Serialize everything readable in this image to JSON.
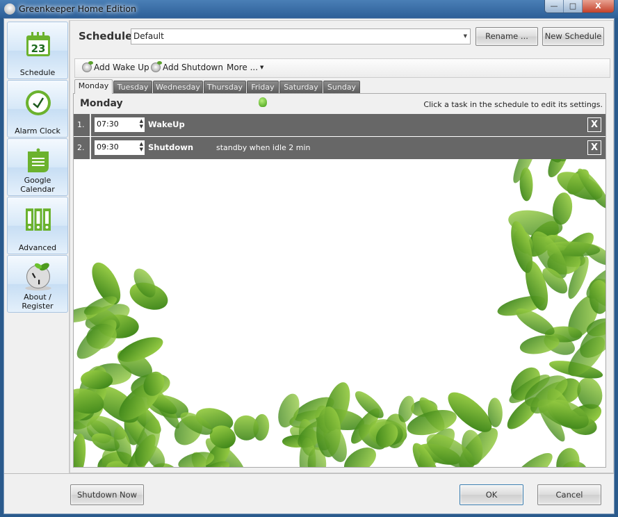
{
  "window": {
    "title": "Greenkeeper Home Edition",
    "min": "—",
    "max": "□",
    "close": "X"
  },
  "sidebar": {
    "items": [
      {
        "label": "Schedule",
        "icon": "calendar-icon",
        "day": "23"
      },
      {
        "label": "Alarm Clock",
        "icon": "clock-icon"
      },
      {
        "label": "Google Calendar",
        "icon": "note-icon"
      },
      {
        "label": "Advanced",
        "icon": "binders-icon"
      },
      {
        "label": "About / Register",
        "icon": "power-plug-icon"
      }
    ]
  },
  "schedule": {
    "label": "Schedule",
    "selected": "Default",
    "rename": "Rename ...",
    "new": "New Schedule"
  },
  "toolbar": {
    "add_wakeup": "Add Wake Up",
    "add_shutdown": "Add Shutdown",
    "more": "More ..."
  },
  "tabs": [
    "Monday",
    "Tuesday",
    "Wednesday",
    "Thursday",
    "Friday",
    "Saturday",
    "Sunday"
  ],
  "panel": {
    "day": "Monday",
    "hint": "Click a task in the schedule to edit its settings.",
    "rows": [
      {
        "num": "1.",
        "time": "07:30",
        "task": "WakeUp",
        "detail": "",
        "remove": "X"
      },
      {
        "num": "2.",
        "time": "09:30",
        "task": "Shutdown",
        "detail": "standby when idle 2 min",
        "remove": "X"
      }
    ]
  },
  "footer": {
    "shutdown_now": "Shutdown Now",
    "ok": "OK",
    "cancel": "Cancel"
  },
  "colors": {
    "accent": "#5aa02c",
    "row_bg": "#676767",
    "title_bar": "#2c5e97"
  }
}
